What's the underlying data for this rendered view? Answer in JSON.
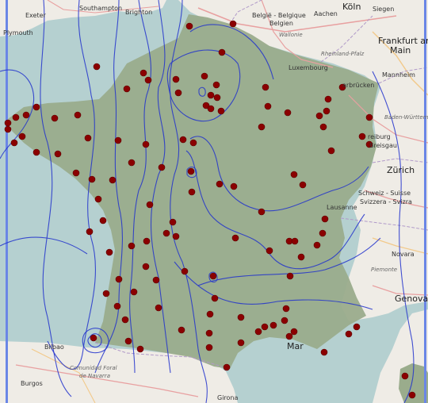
{
  "colors": {
    "land_background": "#efece6",
    "sea": "#b5d0d0",
    "france_overlay": "#9aac8c",
    "contour": "#2233cc",
    "station": "#8b0000",
    "border_bar": "#6a86e6",
    "road_major": "#e8a0a0",
    "road_minor": "#f2c98a"
  },
  "labels": [
    {
      "id": "exeter",
      "text": "Exeter",
      "style": "place"
    },
    {
      "id": "southampton",
      "text": "Southampton",
      "style": "place"
    },
    {
      "id": "brighton",
      "text": "Brighton",
      "style": "place"
    },
    {
      "id": "plymouth",
      "text": "Plymouth",
      "style": "place"
    },
    {
      "id": "koln",
      "text": "Köln",
      "style": "place-big"
    },
    {
      "id": "siegen",
      "text": "Siegen",
      "style": "place"
    },
    {
      "id": "aachen",
      "text": "Aachen",
      "style": "place"
    },
    {
      "id": "belgie",
      "text": "België - Belgique",
      "style": "place"
    },
    {
      "id": "belgien",
      "text": "Belgien",
      "style": "place"
    },
    {
      "id": "wallonie",
      "text": "Wallonie",
      "style": "place-italic"
    },
    {
      "id": "frankfurt1",
      "text": "Frankfurt am",
      "style": "place-big"
    },
    {
      "id": "frankfurt2",
      "text": "Main",
      "style": "place-big"
    },
    {
      "id": "rheinland",
      "text": "Rheinland-Pfalz",
      "style": "place-italic"
    },
    {
      "id": "luxembourg",
      "text": "Luxembourg",
      "style": "place"
    },
    {
      "id": "mannheim",
      "text": "Mannheim",
      "style": "place"
    },
    {
      "id": "saarbrucken",
      "text": "arbrücken",
      "style": "place"
    },
    {
      "id": "baden",
      "text": "Baden-Württem",
      "style": "place-italic"
    },
    {
      "id": "freiburg1",
      "text": "reiburg",
      "style": "place"
    },
    {
      "id": "freiburg2",
      "text": "Breisgau",
      "style": "place"
    },
    {
      "id": "zurich",
      "text": "Zürich",
      "style": "place-big"
    },
    {
      "id": "schweiz1",
      "text": "Schweiz - Suisse",
      "style": "place"
    },
    {
      "id": "schweiz2",
      "text": "Svizzera - Svizra",
      "style": "place"
    },
    {
      "id": "lausanne",
      "text": "Lausanne",
      "style": "place"
    },
    {
      "id": "novara",
      "text": "Novara",
      "style": "place"
    },
    {
      "id": "piemonte",
      "text": "Piemonte",
      "style": "place-italic"
    },
    {
      "id": "genova",
      "text": "Genova",
      "style": "place-big"
    },
    {
      "id": "mar",
      "text": "Mar",
      "style": "place-big"
    },
    {
      "id": "bilbao",
      "text": "Bilbao",
      "style": "place"
    },
    {
      "id": "navarra1",
      "text": "Comunidad Foral",
      "style": "place-italic"
    },
    {
      "id": "navarra2",
      "text": "de Navarra",
      "style": "place-italic"
    },
    {
      "id": "burgos",
      "text": "Burgos",
      "style": "place"
    },
    {
      "id": "girona",
      "text": "Girona",
      "style": "place"
    }
  ]
}
